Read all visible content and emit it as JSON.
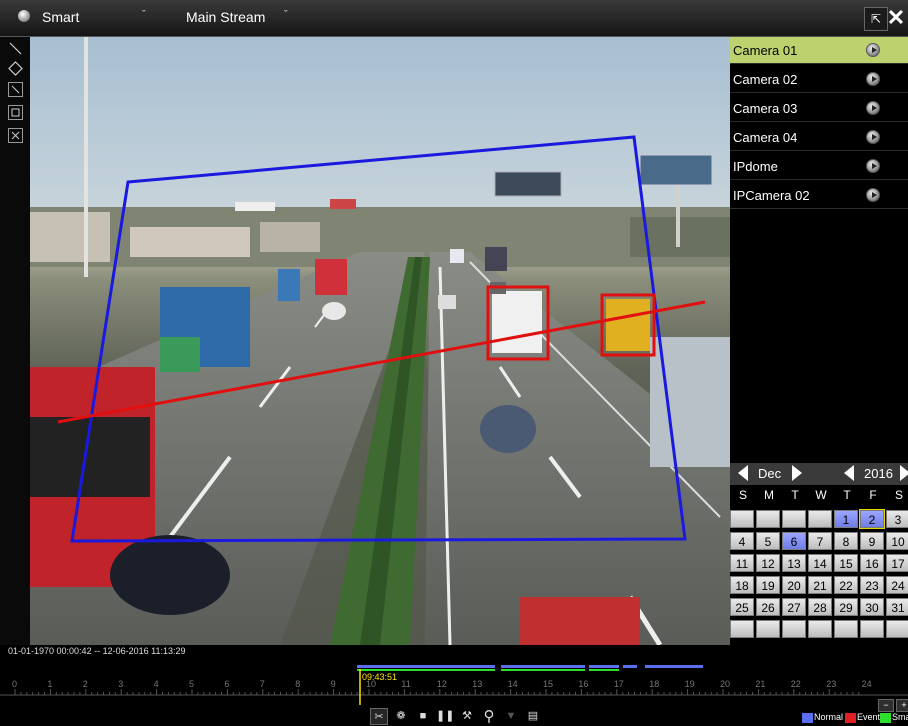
{
  "topbar": {
    "mode_select": "Smart",
    "stream_select": "Main Stream"
  },
  "cameras": [
    {
      "name": "Camera 01",
      "selected": true
    },
    {
      "name": "Camera 02",
      "selected": false
    },
    {
      "name": "Camera 03",
      "selected": false
    },
    {
      "name": "Camera 04",
      "selected": false
    },
    {
      "name": "IPdome",
      "selected": false
    },
    {
      "name": "IPCamera 02",
      "selected": false
    }
  ],
  "calendar": {
    "month": "Dec",
    "year": "2016",
    "weekdays": [
      "S",
      "M",
      "T",
      "W",
      "T",
      "F",
      "S"
    ],
    "rows": [
      [
        "",
        "",
        "",
        "",
        "1",
        "2",
        "3"
      ],
      [
        "4",
        "5",
        "6",
        "7",
        "8",
        "9",
        "10"
      ],
      [
        "11",
        "12",
        "13",
        "14",
        "15",
        "16",
        "17"
      ],
      [
        "18",
        "19",
        "20",
        "21",
        "22",
        "23",
        "24"
      ],
      [
        "25",
        "26",
        "27",
        "28",
        "29",
        "30",
        "31"
      ],
      [
        "",
        "",
        "",
        "",
        "",
        "",
        ""
      ]
    ],
    "recorded_days": [
      "1",
      "2",
      "6"
    ],
    "selected_day": "2"
  },
  "timeline": {
    "range_text": "01-01-1970 00:00:42 -- 12-06-2016 11:13:29",
    "cursor_time": "09:43:51",
    "hours": [
      "0",
      "1",
      "2",
      "3",
      "4",
      "5",
      "6",
      "7",
      "8",
      "9",
      "10",
      "11",
      "12",
      "13",
      "14",
      "15",
      "16",
      "17",
      "18",
      "19",
      "20",
      "21",
      "22",
      "23",
      "24"
    ],
    "zoom_out_label": "−",
    "zoom_in_label": "+"
  },
  "legend": [
    {
      "label": "Normal",
      "color": "#5a6ff0"
    },
    {
      "label": "Event",
      "color": "#e02020"
    },
    {
      "label": "Sma",
      "color": "#2ee02e"
    }
  ],
  "overlay_colors": {
    "detection_area": "#1a1adf",
    "crossing_line": "#e01010",
    "target_box": "#e01010"
  },
  "icons": {
    "mode": "camera-icon",
    "fullscreen": "fullscreen-icon",
    "close": "close-icon",
    "left_tools": [
      "draw-line-icon",
      "draw-polygon-icon",
      "draw-rect-icon",
      "max-size-icon",
      "clear-icon"
    ],
    "controls": [
      "clip-icon",
      "settings-icon",
      "stop-icon",
      "pause-icon",
      "tools-icon",
      "search-icon",
      "filter-icon",
      "storage-icon"
    ]
  }
}
